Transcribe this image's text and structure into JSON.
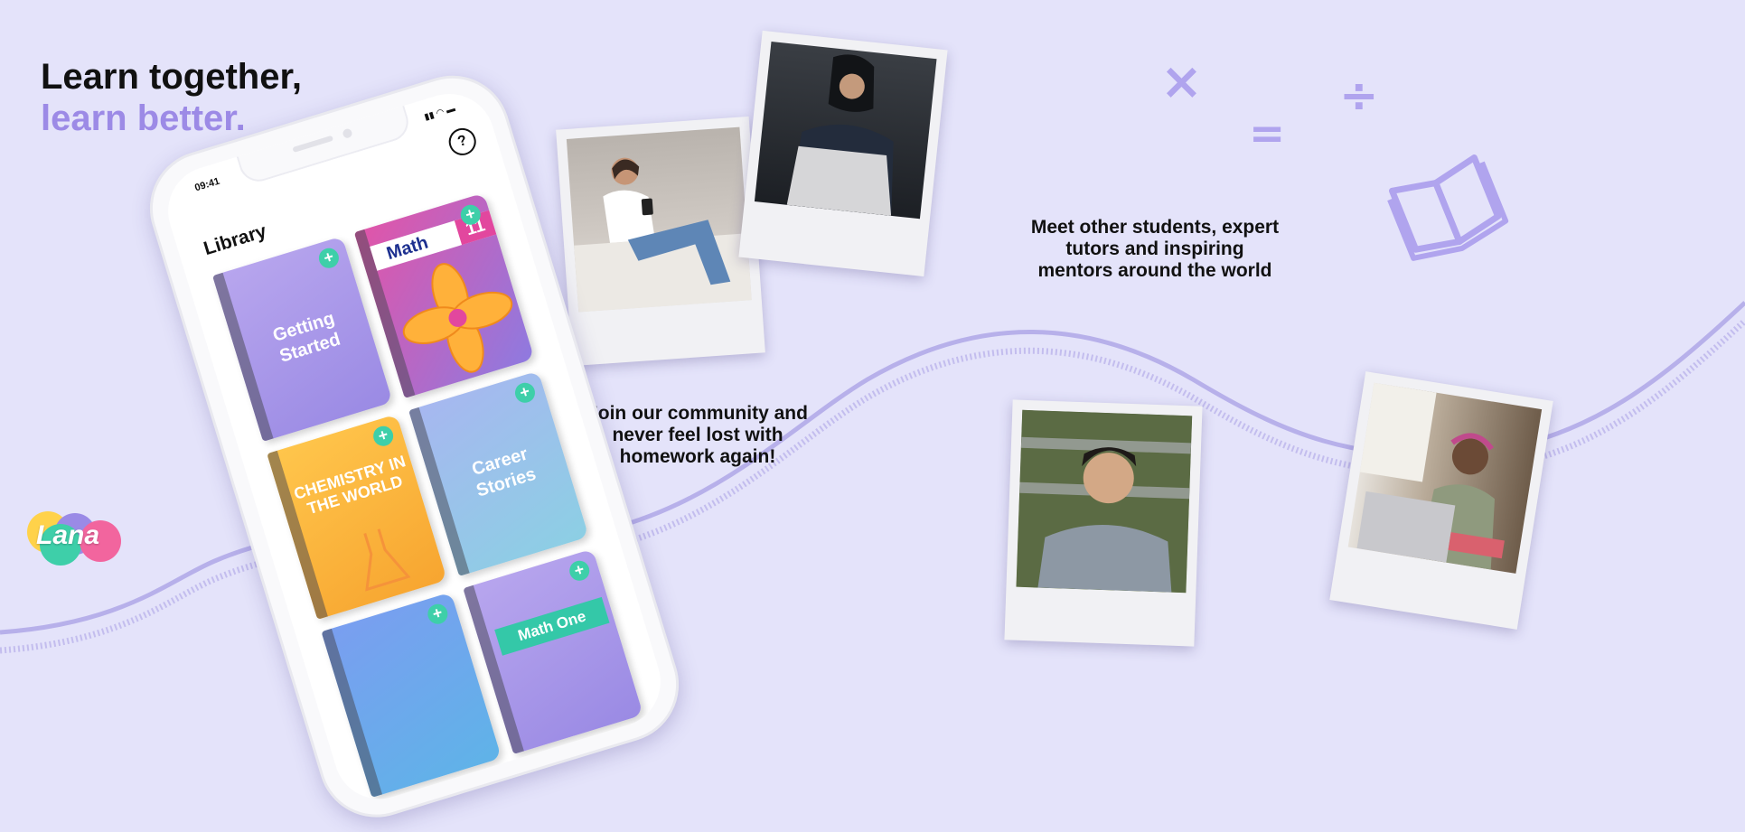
{
  "headline": {
    "line1": "Learn together,",
    "line2": "learn better."
  },
  "captions": {
    "community": [
      "Join our community and",
      "never feel lost with",
      "homework again!"
    ],
    "meet": [
      "Meet other students, expert",
      "tutors and inspiring",
      "mentors around the world"
    ]
  },
  "symbols": {
    "times": "×",
    "equals": "=",
    "divide": "÷"
  },
  "phone": {
    "time": "09:41",
    "status_icons": "▮▮ ◠ ▬",
    "help_glyph": "?",
    "library_title": "Library",
    "books": [
      {
        "title": "Getting Started"
      },
      {
        "title": "Math",
        "number": "11"
      },
      {
        "title": "CHEMISTRY IN THE WORLD"
      },
      {
        "title": "Career Stories"
      },
      {
        "title": ""
      },
      {
        "title": "Math One"
      }
    ],
    "plus_glyph": "+"
  },
  "logo": {
    "text": "Lana"
  },
  "colors": {
    "background": "#e4e3fa",
    "accent": "#9c8ae6",
    "wave": "#b7b0ea",
    "plus": "#3ecfa9"
  }
}
